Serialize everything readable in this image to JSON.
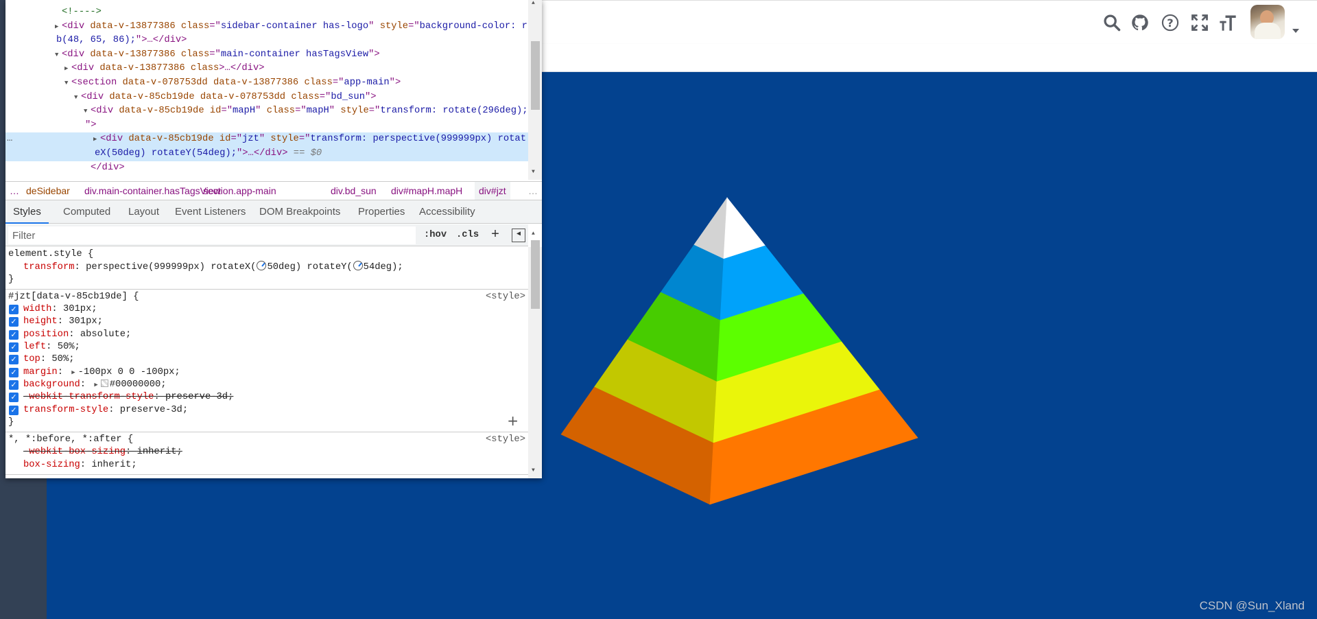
{
  "colors": {
    "sidebar": "#334155",
    "main_bg": "#03428f",
    "selected_row": "#cfe8fc",
    "accent": "#1a73e8"
  },
  "navbar": {
    "icons": [
      "search-icon",
      "github-icon",
      "help-icon",
      "fullscreen-icon",
      "font-size-icon"
    ],
    "avatar": "user-avatar"
  },
  "devtools": {
    "dom_lines": [
      {
        "depth": 0,
        "arrow": "",
        "tokens": [
          [
            "c",
            "<!---->"
          ]
        ]
      },
      {
        "depth": 0,
        "arrow": "right",
        "tokens": [
          [
            "t",
            "<div "
          ],
          [
            "a",
            "data-v-13877386 class"
          ],
          [
            "t",
            "=\""
          ],
          [
            "v",
            "sidebar-container has-logo"
          ],
          [
            "t",
            "\" "
          ],
          [
            "a",
            "style"
          ],
          [
            "t",
            "=\""
          ],
          [
            "v",
            "background-color: rg"
          ]
        ],
        "cont": [
          [
            "v",
            "b(48, 65, 86);"
          ],
          [
            "t",
            "\">…</div>"
          ]
        ]
      },
      {
        "depth": 0,
        "arrow": "down",
        "tokens": [
          [
            "t",
            "<div "
          ],
          [
            "a",
            "data-v-13877386 class"
          ],
          [
            "t",
            "=\""
          ],
          [
            "v",
            "main-container hasTagsView"
          ],
          [
            "t",
            "\">"
          ]
        ]
      },
      {
        "depth": 1,
        "arrow": "right",
        "tokens": [
          [
            "t",
            "<div "
          ],
          [
            "a",
            "data-v-13877386 class"
          ],
          [
            "t",
            ">…</div>"
          ]
        ]
      },
      {
        "depth": 1,
        "arrow": "down",
        "tokens": [
          [
            "t",
            "<section "
          ],
          [
            "a",
            "data-v-078753dd data-v-13877386 class"
          ],
          [
            "t",
            "=\""
          ],
          [
            "v",
            "app-main"
          ],
          [
            "t",
            "\">"
          ]
        ]
      },
      {
        "depth": 2,
        "arrow": "down",
        "tokens": [
          [
            "t",
            "<div "
          ],
          [
            "a",
            "data-v-85cb19de data-v-078753dd class"
          ],
          [
            "t",
            "=\""
          ],
          [
            "v",
            "bd_sun"
          ],
          [
            "t",
            "\">"
          ]
        ]
      },
      {
        "depth": 3,
        "arrow": "down",
        "tokens": [
          [
            "t",
            "<div "
          ],
          [
            "a",
            "data-v-85cb19de id"
          ],
          [
            "t",
            "=\""
          ],
          [
            "v",
            "mapH"
          ],
          [
            "t",
            "\" "
          ],
          [
            "a",
            "class"
          ],
          [
            "t",
            "=\""
          ],
          [
            "v",
            "mapH"
          ],
          [
            "t",
            "\" "
          ],
          [
            "a",
            "style"
          ],
          [
            "t",
            "=\""
          ],
          [
            "v",
            "transform: rotate(296deg);"
          ]
        ],
        "cont": [
          [
            "t",
            "\">"
          ]
        ]
      },
      {
        "depth": 4,
        "arrow": "right",
        "selected": true,
        "tokens": [
          [
            "t",
            "<div "
          ],
          [
            "a",
            "data-v-85cb19de id"
          ],
          [
            "t",
            "=\""
          ],
          [
            "v",
            "jzt"
          ],
          [
            "t",
            "\" "
          ],
          [
            "a",
            "style"
          ],
          [
            "t",
            "=\""
          ],
          [
            "v",
            "transform: perspective(999999px) rotat"
          ]
        ],
        "cont": [
          [
            "v",
            "eX(50deg) rotateY(54deg);"
          ],
          [
            "t",
            "\">…</div>"
          ],
          [
            "d",
            " == $0"
          ]
        ]
      },
      {
        "depth": 3,
        "arrow": "",
        "tokens": [
          [
            "t",
            "</div>"
          ]
        ]
      }
    ],
    "selected_marker": "…",
    "breadcrumbs": [
      {
        "tag": "",
        "cls": "deSidebar"
      },
      {
        "tag": "div",
        "cls": ".main-container.hasTagsView"
      },
      {
        "tag": "section",
        "cls": ".app-main"
      },
      {
        "tag": "div",
        "cls": ".bd_sun"
      },
      {
        "tag": "div",
        "cls": "#mapH.mapH"
      },
      {
        "tag": "div",
        "cls": "#jzt"
      }
    ],
    "breadcrumb_more": "…",
    "tabs": [
      "Styles",
      "Computed",
      "Layout",
      "Event Listeners",
      "DOM Breakpoints",
      "Properties",
      "Accessibility"
    ],
    "active_tab": "Styles",
    "filter_placeholder": "Filter",
    "hov": ":hov",
    "cls": ".cls",
    "add": "+",
    "rules": [
      {
        "selector": "element.style {",
        "source": "",
        "props": [
          {
            "name": "transform",
            "parts": [
              "perspective(999999px) rotateX(",
              "50deg) rotateY(",
              "54deg);"
            ],
            "angles": true
          }
        ]
      },
      {
        "selector": "#jzt[data-v-85cb19de] {",
        "source": "<style>",
        "plus": true,
        "props": [
          {
            "name": "width",
            "value": "301px;",
            "checked": true
          },
          {
            "name": "height",
            "value": "301px;",
            "checked": true
          },
          {
            "name": "position",
            "value": "absolute;",
            "checked": true
          },
          {
            "name": "left",
            "value": "50%;",
            "checked": true
          },
          {
            "name": "top",
            "value": "50%;",
            "checked": true
          },
          {
            "name": "margin",
            "value": "-100px 0 0 -100px;",
            "checked": true,
            "expand": true
          },
          {
            "name": "background",
            "value": "#00000000;",
            "checked": true,
            "expand": true,
            "swatch": true
          },
          {
            "name": "-webkit-transform-style",
            "value": "preserve-3d;",
            "checked": true,
            "struck": true
          },
          {
            "name": "transform-style",
            "value": "preserve-3d;",
            "checked": true
          }
        ]
      },
      {
        "selector": "*, *:before, *:after {",
        "source": "<style>",
        "open": true,
        "props": [
          {
            "name": "-webkit-box-sizing",
            "value": "inherit;",
            "struck": true
          },
          {
            "name": "box-sizing",
            "value": "inherit;"
          }
        ]
      }
    ]
  },
  "pyramid": {
    "levels": 5,
    "face_colors": [
      {
        "left": "#d3d3d3",
        "right": "#ffffff"
      },
      {
        "left": "#0086d0",
        "right": "#00a2fa"
      },
      {
        "left": "#47cc00",
        "right": "#5cff00"
      },
      {
        "left": "#c2c800",
        "right": "#eaf50a"
      },
      {
        "left": "#d46200",
        "right": "#ff7700"
      }
    ]
  },
  "watermark": "CSDN @Sun_Xland"
}
